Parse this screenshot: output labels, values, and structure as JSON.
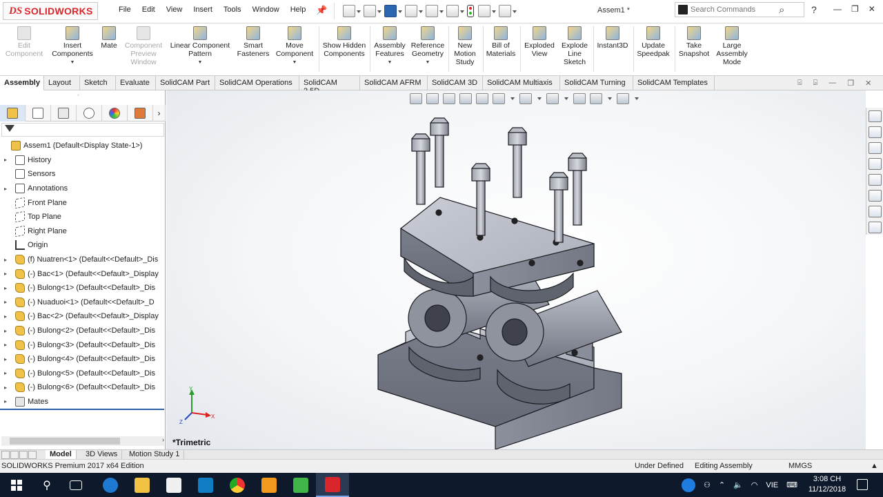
{
  "app": {
    "brand_prefix": "DS",
    "brand_name": "SOLIDWORKS",
    "doc_title": "Assem1 *"
  },
  "menu": [
    "File",
    "Edit",
    "View",
    "Insert",
    "Tools",
    "Window",
    "Help"
  ],
  "search": {
    "placeholder": "Search Commands"
  },
  "help_label": "?",
  "window_controls": [
    "—",
    "❐",
    "✕"
  ],
  "ribbon": [
    {
      "label": "Edit Component",
      "disabled": true
    },
    {
      "label": "Insert Components",
      "disabled": false
    },
    {
      "label": "Mate",
      "disabled": false
    },
    {
      "label": "Component Preview Window",
      "disabled": true
    },
    {
      "label": "Linear Component Pattern",
      "disabled": false
    },
    {
      "label": "Smart Fasteners",
      "disabled": false
    },
    {
      "label": "Move Component",
      "disabled": false
    },
    {
      "label": "Show Hidden Components",
      "disabled": false
    },
    {
      "label": "Assembly Features",
      "disabled": false
    },
    {
      "label": "Reference Geometry",
      "disabled": false
    },
    {
      "label": "New Motion Study",
      "disabled": false
    },
    {
      "label": "Bill of Materials",
      "disabled": false
    },
    {
      "label": "Exploded View",
      "disabled": false
    },
    {
      "label": "Explode Line Sketch",
      "disabled": false
    },
    {
      "label": "Instant3D",
      "disabled": false
    },
    {
      "label": "Update Speedpak",
      "disabled": false
    },
    {
      "label": "Take Snapshot",
      "disabled": false
    },
    {
      "label": "Large Assembly Mode",
      "disabled": false
    }
  ],
  "command_tabs": [
    "Assembly",
    "Layout",
    "Sketch",
    "Evaluate",
    "SolidCAM Part",
    "SolidCAM Operations",
    "SolidCAM 2.5D",
    "SolidCAM AFRM",
    "SolidCAM 3D",
    "SolidCAM Multiaxis",
    "SolidCAM Turning",
    "SolidCAM Templates"
  ],
  "active_command_tab": "Assembly",
  "tree": [
    {
      "label": "Assem1  (Default<Display State-1>)",
      "icon": "assembly-icon",
      "expand": ""
    },
    {
      "label": "History",
      "icon": "folder-icon",
      "expand": "▸"
    },
    {
      "label": "Sensors",
      "icon": "folder-icon",
      "expand": ""
    },
    {
      "label": "Annotations",
      "icon": "folder-icon",
      "expand": "▸"
    },
    {
      "label": "Front Plane",
      "icon": "plane-icon",
      "expand": ""
    },
    {
      "label": "Top Plane",
      "icon": "plane-icon",
      "expand": ""
    },
    {
      "label": "Right Plane",
      "icon": "plane-icon",
      "expand": ""
    },
    {
      "label": "Origin",
      "icon": "origin-icon",
      "expand": ""
    },
    {
      "label": "(f) Nuatren<1> (Default<<Default>_Dis",
      "icon": "part-icon",
      "expand": "▸"
    },
    {
      "label": "(-) Bac<1> (Default<<Default>_Display",
      "icon": "part-icon",
      "expand": "▸"
    },
    {
      "label": "(-) Bulong<1> (Default<<Default>_Dis",
      "icon": "part-icon",
      "expand": "▸"
    },
    {
      "label": "(-) Nuaduoi<1> (Default<<Default>_D",
      "icon": "part-icon",
      "expand": "▸"
    },
    {
      "label": "(-) Bac<2> (Default<<Default>_Display",
      "icon": "part-icon",
      "expand": "▸"
    },
    {
      "label": "(-) Bulong<2> (Default<<Default>_Dis",
      "icon": "part-icon",
      "expand": "▸"
    },
    {
      "label": "(-) Bulong<3> (Default<<Default>_Dis",
      "icon": "part-icon",
      "expand": "▸"
    },
    {
      "label": "(-) Bulong<4> (Default<<Default>_Dis",
      "icon": "part-icon",
      "expand": "▸"
    },
    {
      "label": "(-) Bulong<5> (Default<<Default>_Dis",
      "icon": "part-icon",
      "expand": "▸"
    },
    {
      "label": "(-) Bulong<6> (Default<<Default>_Dis",
      "icon": "part-icon",
      "expand": "▸"
    },
    {
      "label": "Mates",
      "icon": "mates-icon",
      "expand": "▸"
    }
  ],
  "view": {
    "orientation": "*Trimetric",
    "triad": {
      "x": "X",
      "y": "Y",
      "z": "Z"
    }
  },
  "bottom_tabs": [
    "Model",
    "3D Views",
    "Motion Study 1"
  ],
  "active_bottom_tab": "Model",
  "status": {
    "edition": "SOLIDWORKS Premium 2017 x64 Edition",
    "state": "Under Defined",
    "mode": "Editing Assembly",
    "units": "MMGS"
  },
  "tray": {
    "lang": "VIE",
    "time": "3:08 CH",
    "date": "11/12/2018"
  },
  "colors": {
    "accent": "#d8262c",
    "taskbar": "#0e1a2b",
    "model": "#8e929e"
  }
}
